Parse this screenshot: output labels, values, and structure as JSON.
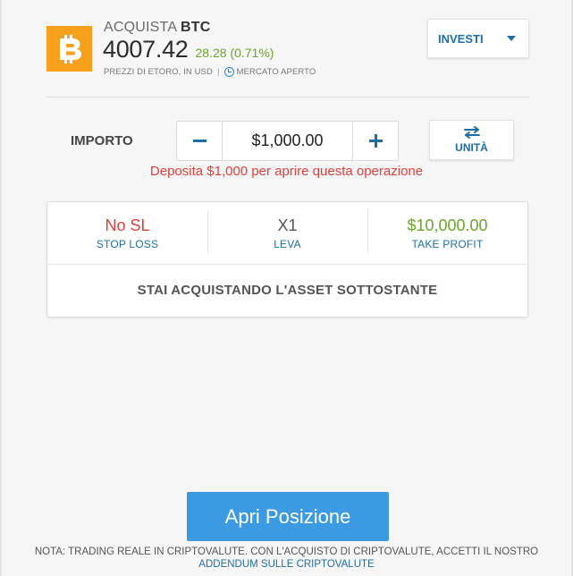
{
  "header": {
    "action": "ACQUISTA",
    "symbol": "BTC",
    "price": "4007.42",
    "change": "28.28 (0.71%)",
    "price_source": "PREZZI DI ETORO, IN USD",
    "separator": "|",
    "market_status": "MERCATO APERTO",
    "invest_button": "INVESTI"
  },
  "amount": {
    "label": "IMPORTO",
    "value": "$1,000.00",
    "unit_button": "UNITÀ",
    "warning": "Deposita $1,000 per aprire questa operazione"
  },
  "settings": {
    "stop_loss": {
      "value": "No SL",
      "label": "STOP LOSS"
    },
    "leverage": {
      "value": "X1",
      "label": "LEVA"
    },
    "take_profit": {
      "value": "$10,000.00",
      "label": "TAKE PROFIT"
    },
    "info": "STAI ACQUISTANDO L'ASSET SOTTOSTANTE"
  },
  "footer": {
    "open_button": "Apri Posizione",
    "note": "NOTA: TRADING REALE IN CRIPTOVALUTE. CON L'ACQUISTO DI CRIPTOVALUTE, ACCETTI IL NOSTRO",
    "link": "ADDENDUM SULLE CRIPTOVALUTE"
  },
  "colors": {
    "bitcoin": "#f7a01b",
    "accent_blue": "#1d6ea8",
    "button_blue": "#3b9ae1",
    "positive_green": "#6aa52c",
    "warning_red": "#e0403b"
  },
  "icons": [
    "bitcoin-logo-icon",
    "clock-icon",
    "chevron-down-icon",
    "minus-icon",
    "plus-icon",
    "swap-arrows-icon"
  ]
}
